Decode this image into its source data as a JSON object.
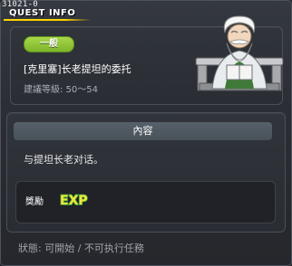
{
  "header": {
    "quest_id": "31021-0",
    "title": "QUEST INFO"
  },
  "quest": {
    "category_badge": "一般",
    "name": "[克里塞]长老提坦的委托",
    "level_range": "建議等級: 50～54"
  },
  "content": {
    "section_title": "內容",
    "description": "与提坦长老对话。",
    "reward_label": "獎勵",
    "reward_exp_label": "EXP"
  },
  "status": {
    "text": "狀態: 可開始 / 不可执行任務"
  },
  "colors": {
    "accent_yellow": "#ffd400",
    "badge_green": "#8cc63f",
    "exp_yellow": "#f4e23a",
    "exp_green": "#3ca83c"
  },
  "icons": {
    "npc": "elder-titan-portrait",
    "reward": "exp-icon"
  }
}
